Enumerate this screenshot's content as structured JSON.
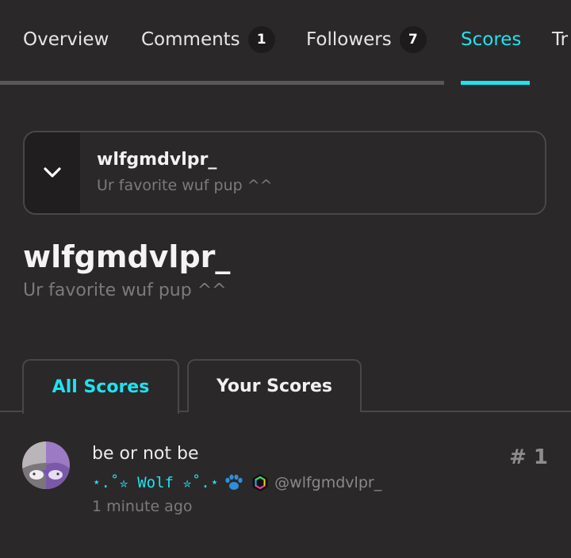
{
  "nav": {
    "tabs": [
      {
        "label": "Overview"
      },
      {
        "label": "Comments",
        "count": "1"
      },
      {
        "label": "Followers",
        "count": "7"
      },
      {
        "label": "Scores"
      },
      {
        "label": "Tr"
      }
    ],
    "active": "Scores"
  },
  "card": {
    "title": "wlfgmdvlpr_",
    "subtitle": "Ur favorite wuf pup ^^"
  },
  "header": {
    "title": "wlfgmdvlpr_",
    "subtitle": "Ur favorite wuf pup ^^"
  },
  "score_tabs": [
    {
      "label": "All Scores",
      "active": true
    },
    {
      "label": "Your Scores",
      "active": false
    }
  ],
  "entries": [
    {
      "title": "be or not be",
      "display_name": "⋆.˚✮ Wolf ✮˚.⋆",
      "paw_icon": "paw-icon",
      "verified_icon": "verified-badge-icon",
      "handle": "@wlfgmdvlpr_",
      "time": "1 minute ago",
      "rank": "# 1"
    }
  ],
  "colors": {
    "background": "#2b2829",
    "accent": "#1ee3ef",
    "muted": "#7d7a7b",
    "border": "#4a4748"
  }
}
